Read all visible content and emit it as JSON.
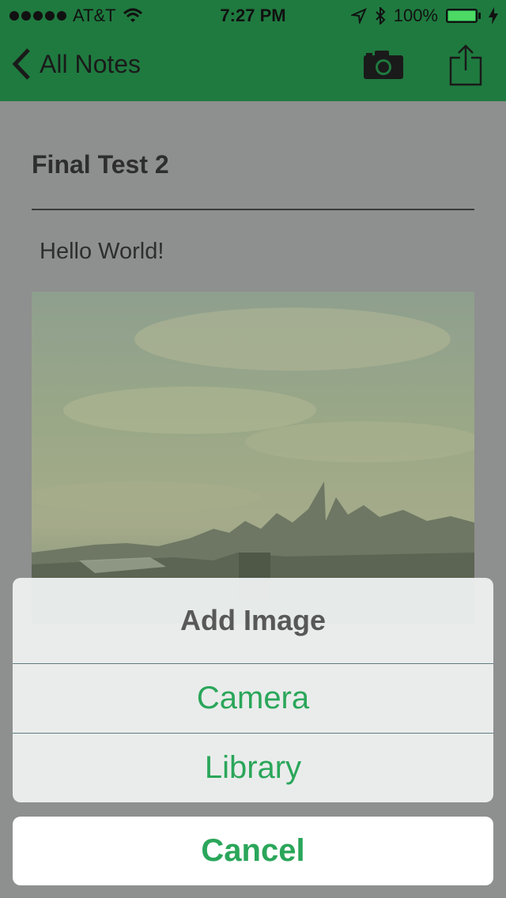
{
  "status_bar": {
    "carrier": "AT&T",
    "time": "7:27 PM",
    "battery": "100%"
  },
  "nav": {
    "back_label": "All Notes"
  },
  "note": {
    "title": "Final Test 2",
    "body": "Hello World!"
  },
  "action_sheet": {
    "title": "Add Image",
    "options": [
      "Camera",
      "Library"
    ],
    "cancel_label": "Cancel"
  },
  "colors": {
    "nav_bar": "#1f7a3f",
    "accent": "#2aa65a"
  }
}
